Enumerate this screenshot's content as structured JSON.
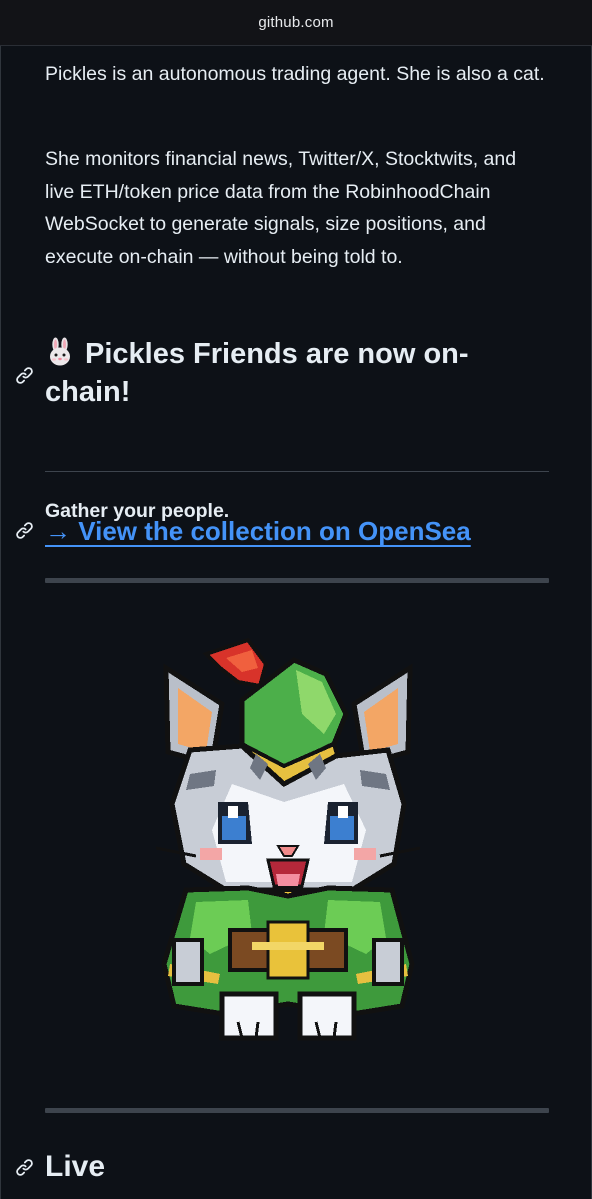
{
  "browser": {
    "url": "github.com"
  },
  "readme": {
    "intro": "Pickles is an autonomous trading agent. She is also a cat.",
    "description": "She monitors financial news, Twitter/X, Stocktwits, and live ETH/token price data from the RobinhoodChain WebSocket to generate signals, size positions, and execute on-chain — without being told to.",
    "friends_heading": "Pickles Friends are now on-chain!",
    "friends_heading_emoji": "rabbit-emoji-icon",
    "tagline": "Gather your people.",
    "opensea_link": "→ View the collection on OpenSea",
    "live_heading": "Live"
  },
  "colors": {
    "background": "#0d1117",
    "text": "#e6edf3",
    "link": "#4493f8",
    "rule": "#3d444d"
  },
  "icons": {
    "anchor": "link-icon",
    "illustration": "pixel-art-cat-robin-hood"
  }
}
